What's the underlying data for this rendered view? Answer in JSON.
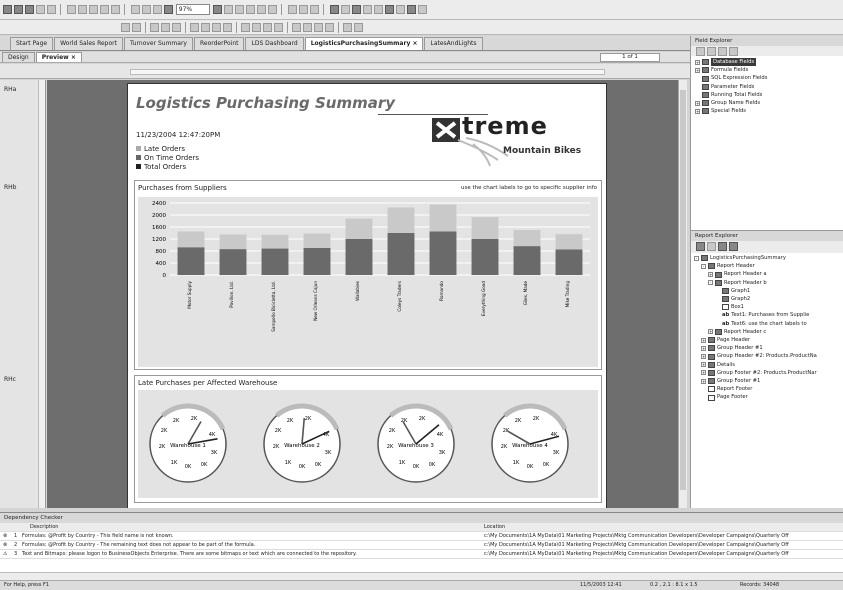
{
  "toolbar": {
    "zoom": "97%"
  },
  "tabs": [
    "Start Page",
    "World Sales Report",
    "Turnover Summary",
    "ReorderPoint",
    "LDS Dashboard",
    "LogisticsPurchasingSummary",
    "LatesAndLights"
  ],
  "view_tabs": {
    "design": "Design",
    "preview": "Preview"
  },
  "page_nav": "1 of 1",
  "sections": {
    "a": "RHa",
    "b": "RHb",
    "c": "RHc"
  },
  "report": {
    "title": "Logistics Purchasing Summary",
    "datetime": "11/23/2004   12:47:20PM",
    "legend": [
      "Late Orders",
      "On Time Orders",
      "Total Orders"
    ],
    "logo_word": "treme",
    "logo_sub": "Mountain Bikes",
    "chart1_title": "Purchases from Suppliers",
    "chart1_note": "use the chart labels to go to specific supplier info",
    "chart2_title": "Late Purchases per Affected Warehouse"
  },
  "chart_data": {
    "type": "bar",
    "title": "Purchases from Suppliers",
    "categories": [
      "Motor Supply",
      "Pavilion, Ltd.",
      "Sampello Bicicletta, Ltd.",
      "New Orleans Cajun",
      "Wallabies",
      "Coleys Traders",
      "Romando",
      "Everything Good",
      "Giles, Made",
      "Mike Trading"
    ],
    "series": [
      {
        "values": [
          920,
          860,
          880,
          900,
          1200,
          1400,
          1450,
          1200,
          960,
          850
        ]
      },
      {
        "values": [
          1450,
          1350,
          1340,
          1380,
          1880,
          2250,
          2350,
          1930,
          1500,
          1360
        ]
      }
    ],
    "ylim": [
      0,
      2400
    ],
    "yticks": [
      0,
      400,
      800,
      1200,
      1600,
      2000,
      2400
    ]
  },
  "gauges": [
    {
      "label": "Warehouse 1",
      "ticks": [
        "0K",
        "1K",
        "2K",
        "2K",
        "2K",
        "2K",
        "4K",
        "3K",
        "0K"
      ]
    },
    {
      "label": "Warehouse 2",
      "ticks": [
        "0K",
        "1K",
        "2K",
        "2K",
        "2K",
        "2K",
        "4K",
        "3K",
        "0K"
      ]
    },
    {
      "label": "Warehouse 3",
      "ticks": [
        "0K",
        "1K",
        "2K",
        "2K",
        "2K",
        "2K",
        "4K",
        "3K",
        "0K"
      ]
    },
    {
      "label": "Warehouse 4",
      "ticks": [
        "0K",
        "1K",
        "2K",
        "2K",
        "2K",
        "2K",
        "4K",
        "3K",
        "0K"
      ]
    }
  ],
  "field_explorer": {
    "title": "Field Explorer",
    "items": [
      "Database Fields",
      "Formula Fields",
      "SQL Expression Fields",
      "Parameter Fields",
      "Running Total Fields",
      "Group Name Fields",
      "Special Fields"
    ]
  },
  "report_explorer": {
    "title": "Report Explorer",
    "items": [
      "LogisticsPurchasingSummary",
      "Report Header",
      "Report Header a",
      "Report Header b",
      "Graph1",
      "Graph2",
      "Box1",
      "Text1: Purchases from Supplie",
      "Text6: use the chart labels to",
      "Report Header c",
      "Page Header",
      "Group Header #1",
      "Group Header #2: Products.ProductNa",
      "Details",
      "Group Footer #2: Products.ProductNar",
      "Group Footer #1",
      "Report Footer",
      "Page Footer"
    ]
  },
  "dependency": {
    "title": "Dependency Checker",
    "col_desc": "Description",
    "col_loc": "Location",
    "rows": [
      {
        "n": "1",
        "desc": "Formulas: @Profit by Country - This field name is not known.",
        "loc": "c:\\My Documents\\1A MyData\\01 Marketing Projects\\Mktg Communication Developers\\Developer Campaigns\\Quarterly Off"
      },
      {
        "n": "2",
        "desc": "Formulas: @Profit by Country - The remaining text does not appear to be part of the formula.",
        "loc": "c:\\My Documents\\1A MyData\\01 Marketing Projects\\Mktg Communication Developers\\Developer Campaigns\\Quarterly Off"
      },
      {
        "n": "3",
        "desc": "Text and Bitmaps: please logon to BusinessObjects Enterprise. There are some bitmaps or text which are connected to the repository.",
        "loc": "c:\\My Documents\\1A MyData\\01 Marketing Projects\\Mktg Communication Developers\\Developer Campaigns\\Quarterly Off"
      }
    ]
  },
  "status": {
    "left": "For Help, press F1",
    "date": "11/5/2003  12:41",
    "pos": "0.2 , 2.1 : 8.1 x 1.5",
    "records": "Records: 34048"
  }
}
